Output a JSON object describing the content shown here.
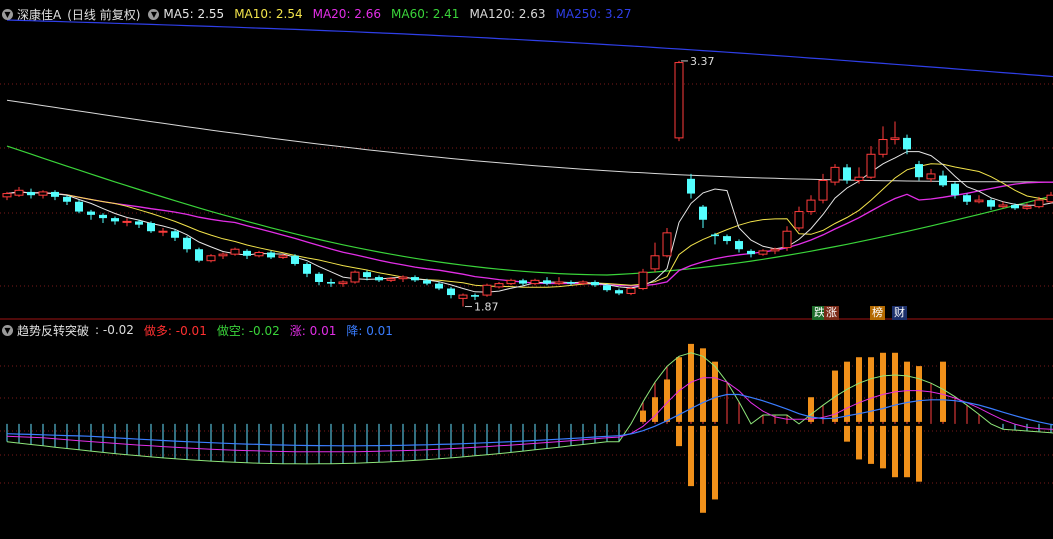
{
  "header": {
    "stock_name": "深康佳A",
    "period": "(日线 前复权)",
    "ma": [
      {
        "label": "MA5: 2.55",
        "color": "#e6e6e6"
      },
      {
        "label": "MA10: 2.54",
        "color": "#f2e34b"
      },
      {
        "label": "MA20: 2.66",
        "color": "#e22ee6"
      },
      {
        "label": "MA60: 2.41",
        "color": "#3ad43a"
      },
      {
        "label": "MA120: 2.63",
        "color": "#d9d9d9"
      },
      {
        "label": "MA250: 3.27",
        "color": "#2f3fe8"
      }
    ]
  },
  "indicator": {
    "name": "趋势反转突破",
    "value_label": ": -0.02",
    "items": [
      {
        "label": "做多: -0.01",
        "color": "#ff3030"
      },
      {
        "label": "做空: -0.02",
        "color": "#3ad43a"
      },
      {
        "label": "涨: 0.01",
        "color": "#e22ee6"
      },
      {
        "label": "降: 0.01",
        "color": "#3a7dff"
      }
    ]
  },
  "tags": [
    {
      "text": "跌",
      "style": "green"
    },
    {
      "text": "涨",
      "style": "red"
    },
    {
      "text": "榜",
      "style": "orange"
    },
    {
      "text": "财",
      "style": "blue"
    }
  ],
  "chart_data": {
    "type": "candlestick",
    "price_range": [
      1.8,
      3.62
    ],
    "annotations": [
      {
        "text": "3.37",
        "index": 56,
        "value": 3.37
      },
      {
        "text": "1.87",
        "index": 38,
        "value": 1.87
      }
    ],
    "candles": [
      [
        2.54,
        2.56,
        2.57,
        2.52
      ],
      [
        2.55,
        2.58,
        2.6,
        2.54
      ],
      [
        2.57,
        2.55,
        2.59,
        2.53
      ],
      [
        2.55,
        2.57,
        2.58,
        2.53
      ],
      [
        2.57,
        2.54,
        2.58,
        2.52
      ],
      [
        2.54,
        2.51,
        2.55,
        2.49
      ],
      [
        2.51,
        2.45,
        2.52,
        2.44
      ],
      [
        2.45,
        2.43,
        2.46,
        2.4
      ],
      [
        2.43,
        2.41,
        2.44,
        2.38
      ],
      [
        2.41,
        2.39,
        2.42,
        2.37
      ],
      [
        2.39,
        2.39,
        2.41,
        2.36
      ],
      [
        2.39,
        2.37,
        2.4,
        2.35
      ],
      [
        2.38,
        2.33,
        2.39,
        2.32
      ],
      [
        2.33,
        2.33,
        2.35,
        2.3
      ],
      [
        2.33,
        2.29,
        2.34,
        2.27
      ],
      [
        2.29,
        2.22,
        2.3,
        2.2
      ],
      [
        2.22,
        2.15,
        2.23,
        2.14
      ],
      [
        2.15,
        2.18,
        2.19,
        2.14
      ],
      [
        2.18,
        2.19,
        2.2,
        2.16
      ],
      [
        2.19,
        2.22,
        2.23,
        2.18
      ],
      [
        2.21,
        2.18,
        2.22,
        2.16
      ],
      [
        2.18,
        2.2,
        2.21,
        2.17
      ],
      [
        2.2,
        2.17,
        2.21,
        2.16
      ],
      [
        2.17,
        2.18,
        2.19,
        2.16
      ],
      [
        2.18,
        2.13,
        2.19,
        2.12
      ],
      [
        2.13,
        2.07,
        2.14,
        2.05
      ],
      [
        2.07,
        2.02,
        2.08,
        2.0
      ],
      [
        2.02,
        2.01,
        2.04,
        1.99
      ],
      [
        2.01,
        2.02,
        2.03,
        1.99
      ],
      [
        2.02,
        2.08,
        2.09,
        2.01
      ],
      [
        2.08,
        2.05,
        2.09,
        2.03
      ],
      [
        2.05,
        2.03,
        2.06,
        2.02
      ],
      [
        2.03,
        2.04,
        2.05,
        2.02
      ],
      [
        2.04,
        2.05,
        2.06,
        2.02
      ],
      [
        2.05,
        2.03,
        2.06,
        2.02
      ],
      [
        2.03,
        2.01,
        2.04,
        2.0
      ],
      [
        2.01,
        1.98,
        2.02,
        1.97
      ],
      [
        1.98,
        1.94,
        1.99,
        1.92
      ],
      [
        1.92,
        1.94,
        1.95,
        1.87
      ],
      [
        1.94,
        1.93,
        1.95,
        1.91
      ],
      [
        1.94,
        2.0,
        2.01,
        1.93
      ],
      [
        1.99,
        2.01,
        2.02,
        1.98
      ],
      [
        2.01,
        2.03,
        2.04,
        2.0
      ],
      [
        2.03,
        2.01,
        2.04,
        2.0
      ],
      [
        2.01,
        2.03,
        2.04,
        2.0
      ],
      [
        2.03,
        2.01,
        2.05,
        2.0
      ],
      [
        2.01,
        2.02,
        2.05,
        2.0
      ],
      [
        2.02,
        2.01,
        2.03,
        2.0
      ],
      [
        2.01,
        2.02,
        2.03,
        2.0
      ],
      [
        2.02,
        2.0,
        2.03,
        1.99
      ],
      [
        2.0,
        1.97,
        2.01,
        1.96
      ],
      [
        1.97,
        1.95,
        1.98,
        1.94
      ],
      [
        1.95,
        1.98,
        1.99,
        1.94
      ],
      [
        1.98,
        2.08,
        2.1,
        1.97
      ],
      [
        2.1,
        2.18,
        2.26,
        2.08
      ],
      [
        2.18,
        2.32,
        2.35,
        2.17
      ],
      [
        2.9,
        3.36,
        3.37,
        2.88
      ],
      [
        2.65,
        2.56,
        2.68,
        2.53
      ],
      [
        2.48,
        2.4,
        2.49,
        2.35
      ],
      [
        2.31,
        2.3,
        2.32,
        2.25
      ],
      [
        2.3,
        2.27,
        2.31,
        2.25
      ],
      [
        2.27,
        2.22,
        2.28,
        2.2
      ],
      [
        2.21,
        2.19,
        2.22,
        2.17
      ],
      [
        2.19,
        2.21,
        2.22,
        2.18
      ],
      [
        2.21,
        2.22,
        2.23,
        2.19
      ],
      [
        2.23,
        2.33,
        2.36,
        2.21
      ],
      [
        2.35,
        2.45,
        2.48,
        2.33
      ],
      [
        2.45,
        2.52,
        2.55,
        2.43
      ],
      [
        2.52,
        2.64,
        2.68,
        2.5
      ],
      [
        2.63,
        2.72,
        2.74,
        2.61
      ],
      [
        2.72,
        2.64,
        2.74,
        2.62
      ],
      [
        2.64,
        2.66,
        2.72,
        2.62
      ],
      [
        2.66,
        2.8,
        2.85,
        2.65
      ],
      [
        2.8,
        2.89,
        2.97,
        2.78
      ],
      [
        2.89,
        2.9,
        3.0,
        2.86
      ],
      [
        2.9,
        2.83,
        2.92,
        2.8
      ],
      [
        2.74,
        2.66,
        2.76,
        2.64
      ],
      [
        2.65,
        2.68,
        2.71,
        2.63
      ],
      [
        2.67,
        2.61,
        2.7,
        2.6
      ],
      [
        2.62,
        2.55,
        2.63,
        2.53
      ],
      [
        2.55,
        2.51,
        2.56,
        2.49
      ],
      [
        2.51,
        2.52,
        2.55,
        2.5
      ],
      [
        2.52,
        2.48,
        2.53,
        2.46
      ],
      [
        2.48,
        2.49,
        2.51,
        2.47
      ],
      [
        2.49,
        2.47,
        2.5,
        2.46
      ],
      [
        2.47,
        2.48,
        2.5,
        2.46
      ],
      [
        2.48,
        2.52,
        2.54,
        2.47
      ],
      [
        2.51,
        2.55,
        2.57,
        2.5
      ],
      [
        2.53,
        2.54,
        2.62,
        2.52
      ]
    ]
  },
  "indicator_data": {
    "value_range": [
      -0.25,
      0.2
    ],
    "bars_orange": [
      {
        "index": 53,
        "up": 0.03,
        "down": 0
      },
      {
        "index": 54,
        "up": 0.06,
        "down": 0
      },
      {
        "index": 55,
        "up": 0.1,
        "down": 0
      },
      {
        "index": 56,
        "up": 0.15,
        "down": -0.05
      },
      {
        "index": 57,
        "up": 0.18,
        "down": -0.14
      },
      {
        "index": 58,
        "up": 0.17,
        "down": -0.2
      },
      {
        "index": 59,
        "up": 0.14,
        "down": -0.17
      },
      {
        "index": 67,
        "up": 0.06,
        "down": 0
      },
      {
        "index": 69,
        "up": 0.12,
        "down": 0
      },
      {
        "index": 70,
        "up": 0.14,
        "down": -0.04
      },
      {
        "index": 71,
        "up": 0.15,
        "down": -0.08
      },
      {
        "index": 72,
        "up": 0.15,
        "down": -0.09
      },
      {
        "index": 73,
        "up": 0.16,
        "down": -0.1
      },
      {
        "index": 74,
        "up": 0.16,
        "down": -0.12
      },
      {
        "index": 75,
        "up": 0.14,
        "down": -0.12
      },
      {
        "index": 76,
        "up": 0.13,
        "down": -0.13
      },
      {
        "index": 78,
        "up": 0.14,
        "down": 0
      }
    ]
  }
}
